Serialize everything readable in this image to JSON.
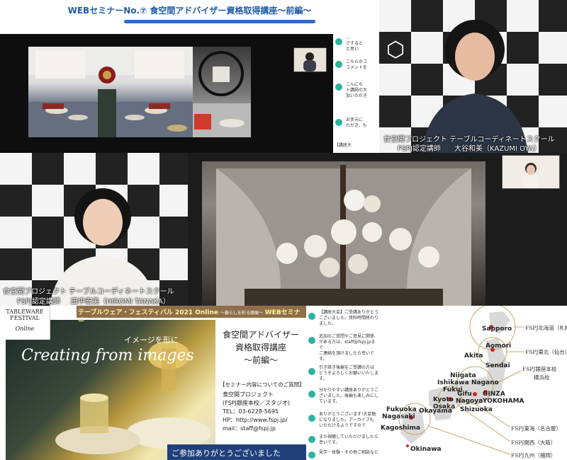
{
  "header": {
    "title": "WEBセミナーNo.⑦ 食空間アドバイザー資格取得講座～前編～"
  },
  "speaker_top_right": {
    "org": "食空間プロジェクト テーブルコーディネートスクール",
    "role": "FSPJ認定講師",
    "name": "大谷和美（KAZUMI OYA）"
  },
  "speaker_left": {
    "org": "食空間プロジェクト テーブルコーディネートスクール",
    "role": "FSPJ認定講師",
    "name": "田中宏美（HIROMI TANAKA）"
  },
  "chat_top": {
    "items": [
      {
        "text": "…\nクすると\nと思い"
      },
      {
        "text": "こちらのコ\nコメントを"
      },
      {
        "text": "こんにち\nト講師の大\n加いただき"
      },
      {
        "text": "お手元に\nただき、も"
      },
      {
        "text": "【講座大"
      }
    ]
  },
  "slide": {
    "logo_line1": "TABLEWARE",
    "logo_line2": "FESTIVAL",
    "logo_line3": "Online",
    "banner_prefix": "テーブルウェア・フェスティバル 2021 Online",
    "banner_sub": "～暮らしを彩る器展～",
    "banner_suffix": "WEBセミナー",
    "script_jp": "イメージを形に",
    "script_en": "Creating from images",
    "course_line1": "食空間アドバイザー",
    "course_line2": "資格取得講座",
    "course_line3": "～前編～",
    "contact_header": "【セミナー内容についてのご質問】",
    "contact_org": "食空間プロジェクト",
    "contact_org2": "(FSPJ銀座本校／スタジオ)",
    "contact_tel": "TEL：03-6228-5695",
    "contact_hp": "HP：http://www.fspj.jp/",
    "contact_mail": "mail：staff@fspj.jp",
    "footer": "ご参加ありがとうございました"
  },
  "chat_bottom": {
    "items": [
      {
        "text": "【講座大会】ご受講ありがとう\nございました。資料時間終わり\nました。"
      },
      {
        "text": "追加のご質問やご意見に関係\nがある方は、staff@fspj.jpまで\nご連絡を頂けましたら幸いで\nす。"
      },
      {
        "text": "引き続き後編をご受講の方は\nどうぞよろしくお願いいたしま\nす。"
      },
      {
        "text": "分かりやすい講座ありがとうご\nざいました。後編も楽しみにし\nています。"
      },
      {
        "text": "ありがとうございます!大変勉\nになりました。アーカイブも\nいただけるようですので"
      },
      {
        "text": "また視聴していただけましたら\n幸いです。"
      },
      {
        "text": "見学・体験・その他ご相談など"
      }
    ]
  },
  "map": {
    "cities": [
      "Sapporo",
      "Aomori",
      "Akita",
      "Sendai",
      "Niigata",
      "Ishikawa",
      "Nagano",
      "Fukui",
      "Gifu",
      "Nagoya",
      "Kyoto",
      "Osaka",
      "Shizuoka",
      "GINZA",
      "YOKOHAMA",
      "Fukuoka",
      "Nagasaki",
      "Okayama",
      "Kagoshima",
      "Okinawa"
    ],
    "branches": [
      "FSPJ北海道（札幌）",
      "FSPJ東北（仙台）",
      "FSPJ銀座本校",
      "横浜校",
      "FSPJ東海（名古屋）",
      "FSPJ関西（大阪）",
      "FSPJ九州（福岡）"
    ]
  }
}
